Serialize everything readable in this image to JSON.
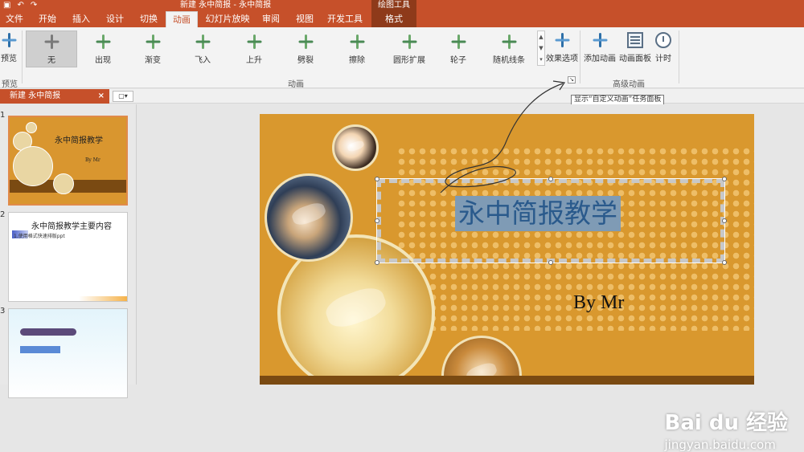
{
  "title_bar": {
    "window_title": "新建 永中简报 - 永中简报",
    "tool_group": "绘图工具"
  },
  "tabs": [
    {
      "label": "文件"
    },
    {
      "label": "开始"
    },
    {
      "label": "插入"
    },
    {
      "label": "设计"
    },
    {
      "label": "切换"
    },
    {
      "label": "动画"
    },
    {
      "label": "幻灯片放映"
    },
    {
      "label": "审阅"
    },
    {
      "label": "视图"
    },
    {
      "label": "开发工具"
    },
    {
      "label": "格式"
    }
  ],
  "active_tab": "动画",
  "ribbon": {
    "preview": {
      "label": "预览",
      "group": "预览"
    },
    "animations": [
      {
        "label": "无"
      },
      {
        "label": "出现"
      },
      {
        "label": "渐变"
      },
      {
        "label": "飞入"
      },
      {
        "label": "上升"
      },
      {
        "label": "劈裂"
      },
      {
        "label": "擦除"
      },
      {
        "label": "圆形扩展"
      },
      {
        "label": "轮子"
      },
      {
        "label": "随机线条"
      }
    ],
    "effect_options": "效果选项",
    "animation_group": "动画",
    "add_animation": "添加动画",
    "animation_pane": "动画面板",
    "timing": "计时",
    "advanced_group": "高级动画"
  },
  "doc_tab": {
    "label": "新建 永中简报",
    "close": "×"
  },
  "tooltip": "显示“自定义动画”任务面板",
  "thumbnails": [
    {
      "number": "1",
      "title": "永中简报教学",
      "subtitle": "By Mr"
    },
    {
      "number": "2",
      "title": "永中简报教学主要内容",
      "line": "1.使用格式快速排版ppt"
    },
    {
      "number": "3"
    }
  ],
  "slide": {
    "title": "永中简报教学",
    "subtitle": "By Mr"
  },
  "watermark": {
    "logo": "Bai du 经验",
    "url": "jingyan.baidu.com"
  },
  "colors": {
    "accent": "#c6502a",
    "slide_bg": "#d9982e",
    "band": "#7a4a12"
  }
}
